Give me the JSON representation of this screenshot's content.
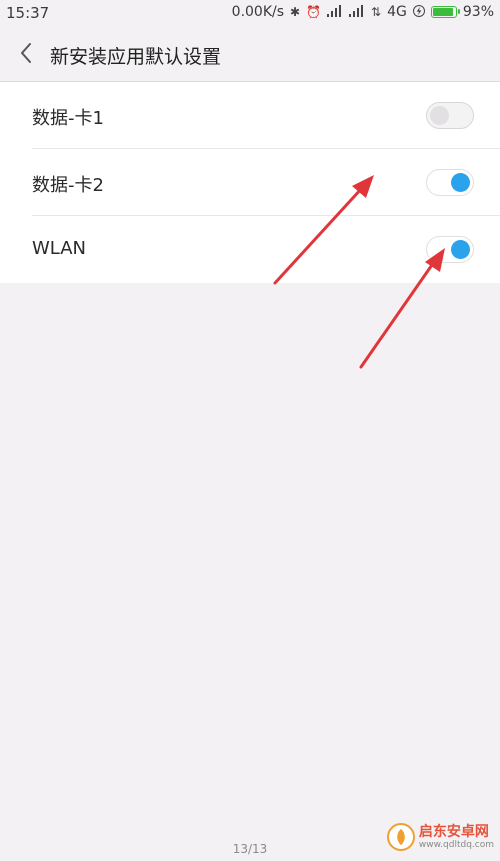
{
  "status_bar": {
    "time": "15:37",
    "network_speed": "0.00K/s",
    "network_type": "4G",
    "battery_percent": "93%",
    "battery_level": 0.93,
    "icons": [
      "bluetooth-icon",
      "alarm-icon",
      "signal-icon",
      "signal-icon",
      "data-arrows-icon",
      "charging-icon",
      "battery-icon"
    ]
  },
  "header": {
    "title": "新安装应用默认设置",
    "back_icon": "chevron-left-icon"
  },
  "settings": [
    {
      "label": "数据-卡1",
      "enabled": false
    },
    {
      "label": "数据-卡2",
      "enabled": true
    },
    {
      "label": "WLAN",
      "enabled": true
    }
  ],
  "footer": {
    "page_indicator": "13/13"
  },
  "watermark": {
    "name": "启东安卓网",
    "url": "www.qdltdq.com"
  },
  "colors": {
    "toggle_on": "#2aa3ec",
    "toggle_off": "#e2e0e2",
    "annotation_arrow": "#e0353a",
    "background": "#f3f1f3"
  }
}
